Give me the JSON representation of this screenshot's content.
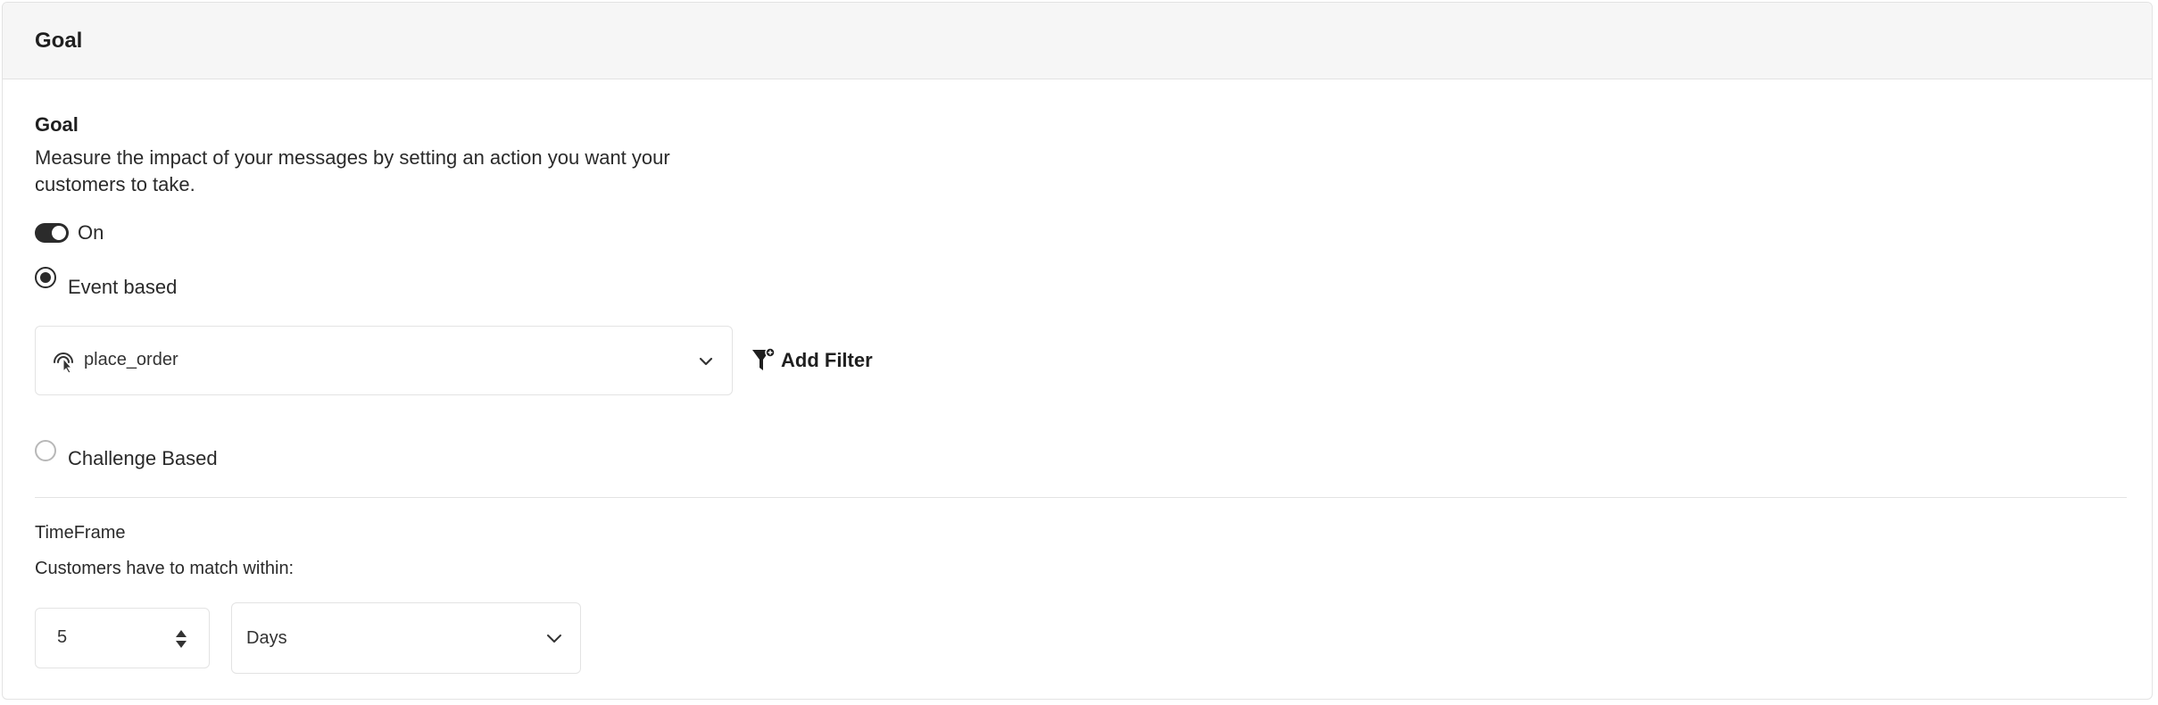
{
  "header": {
    "title": "Goal"
  },
  "goal": {
    "title": "Goal",
    "description": "Measure the impact of your messages by setting an action you want your customers to take.",
    "toggle": {
      "label": "On",
      "checked": true
    },
    "options": {
      "event_based": {
        "label": "Event based",
        "checked": true
      },
      "challenge_based": {
        "label": "Challenge Based",
        "checked": false
      }
    },
    "event_select": {
      "value": "place_order",
      "icon": "tap-gesture-icon"
    },
    "add_filter": {
      "label": "Add Filter",
      "icon": "filter-icon"
    }
  },
  "timeframe": {
    "title": "TimeFrame",
    "hint": "Customers have to match within:",
    "amount": "5",
    "unit": "Days"
  },
  "colors": {
    "header_bg": "#f6f6f6",
    "border": "#e3e3e3",
    "toggle_on": "#2b2b2b",
    "text": "#222222"
  }
}
